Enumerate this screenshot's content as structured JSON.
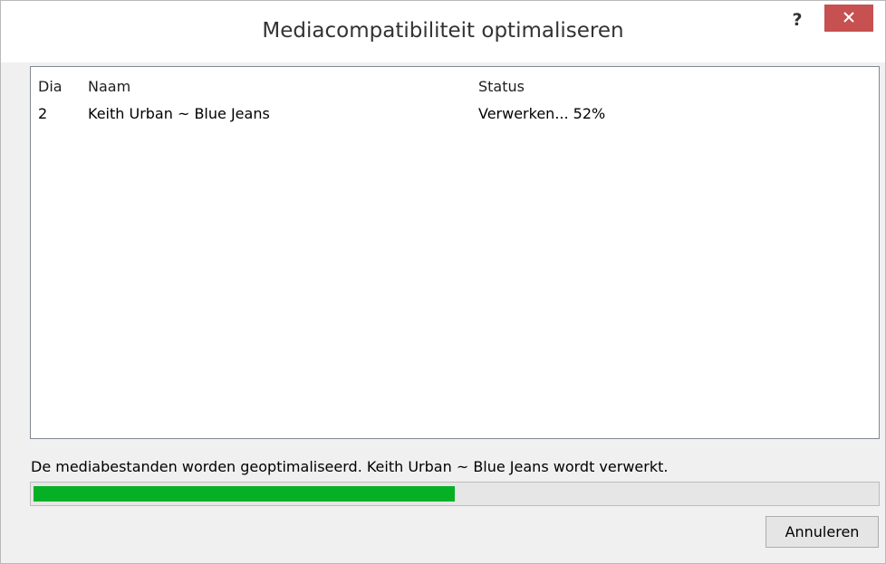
{
  "window": {
    "title": "Mediacompatibiliteit optimaliseren",
    "help_label": "?",
    "close_icon": "close-icon"
  },
  "list": {
    "columns": [
      "Dia",
      "Naam",
      "Status"
    ],
    "rows": [
      {
        "dia": "2",
        "naam": "Keith Urban ~ Blue Jeans",
        "status": "Verwerken... 52%"
      }
    ]
  },
  "message": "De mediabestanden worden geoptimaliseerd. Keith Urban ~ Blue Jeans wordt verwerkt.",
  "progress": {
    "fraction": 0.5,
    "color": "#06b025"
  },
  "buttons": {
    "cancel_label": "Annuleren"
  },
  "colors": {
    "close_button": "#c75050",
    "progress_fill": "#06b025"
  }
}
